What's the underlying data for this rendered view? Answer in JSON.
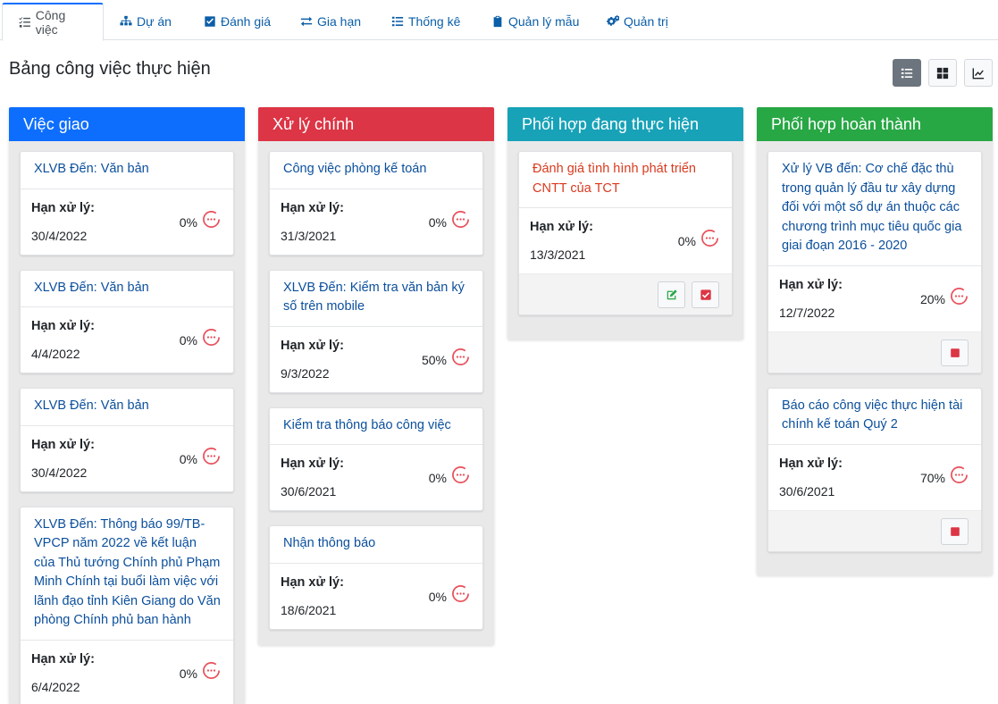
{
  "tabs": [
    {
      "label": "Công việc",
      "icon": "tasks-icon",
      "active": true
    },
    {
      "label": "Dự án",
      "icon": "sitemap-icon"
    },
    {
      "label": "Đánh giá",
      "icon": "check-square-icon"
    },
    {
      "label": "Gia hạn",
      "icon": "exchange-icon"
    },
    {
      "label": "Thống kê",
      "icon": "list-icon"
    },
    {
      "label": "Quản lý mẫu",
      "icon": "clipboard-icon"
    },
    {
      "label": "Quản trị",
      "icon": "cogs-icon"
    }
  ],
  "page": {
    "title": "Bảng công việc thực hiện",
    "view_buttons": [
      "list-view-icon",
      "grid-view-icon",
      "chart-view-icon"
    ]
  },
  "colors": {
    "viec_giao": "#0d6efd",
    "xu_ly_chinh": "#dc3545",
    "phoi_hop_dang": "#17a2b8",
    "phoi_hop_xong": "#28a745",
    "progress_ring": "#e8505b"
  },
  "deadline_label": "Hạn xử lý:",
  "columns": [
    {
      "header": "Việc giao",
      "cards": [
        {
          "title": "XLVB Đến: Văn bản",
          "pct": "0%",
          "date": "30/4/2022"
        },
        {
          "title": "XLVB Đến: Văn bản",
          "pct": "0%",
          "date": "4/4/2022"
        },
        {
          "title": "XLVB Đến: Văn bản",
          "pct": "0%",
          "date": "30/4/2022"
        },
        {
          "title": "XLVB Đến: Thông báo 99/TB-VPCP năm 2022 về kết luận của Thủ tướng Chính phủ Phạm Minh Chính tại buổi làm việc với lãnh đạo tỉnh Kiên Giang do Văn phòng Chính phủ ban hành",
          "pct": "0%",
          "date": "6/4/2022"
        }
      ]
    },
    {
      "header": "Xử lý chính",
      "cards": [
        {
          "title": "Công việc phòng kế toán",
          "pct": "0%",
          "date": "31/3/2021"
        },
        {
          "title": "XLVB Đến: Kiểm tra văn bản ký số trên mobile",
          "pct": "50%",
          "date": "9/3/2022"
        },
        {
          "title": "Kiểm tra thông báo công việc",
          "pct": "0%",
          "date": "30/6/2021"
        },
        {
          "title": "Nhận thông báo",
          "pct": "0%",
          "date": "18/6/2021"
        }
      ]
    },
    {
      "header": "Phối hợp đang thực hiện",
      "cards": [
        {
          "title": "Đánh giá tình hình phát triển CNTT của TCT",
          "pct": "0%",
          "date": "13/3/2021"
        }
      ]
    },
    {
      "header": "Phối hợp hoàn thành",
      "cards": [
        {
          "title": "Xử lý VB đến: Cơ chế đặc thù trong quản lý đầu tư xây dựng đối với một số dự án thuộc các chương trình mục tiêu quốc gia giai đoạn 2016 - 2020",
          "pct": "20%",
          "date": "12/7/2022"
        },
        {
          "title": "Báo cáo công việc thực hiện tài chính kế toán Quý 2",
          "pct": "70%",
          "date": "30/6/2021"
        }
      ]
    }
  ]
}
